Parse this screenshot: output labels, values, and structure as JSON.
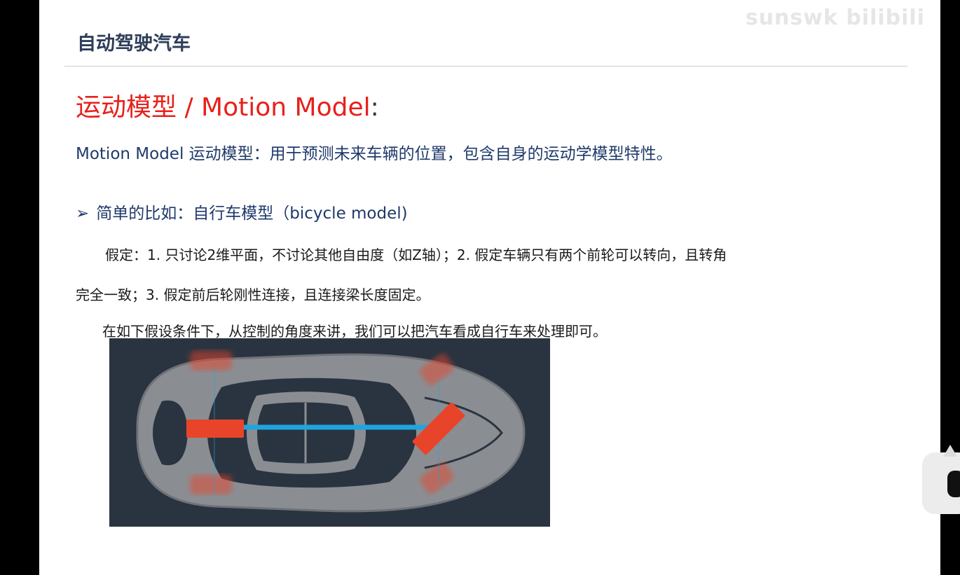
{
  "header": {
    "title": "自动驾驶汽车",
    "watermark": "sunswk bilibili"
  },
  "section": {
    "title": "运动模型 / Motion Model",
    "colon": ":"
  },
  "intro": "Motion Model 运动模型：用于预测未来车辆的位置，包含自身的运动学模型特性。",
  "bullet": {
    "arrow": "➢",
    "text": "简单的比如：自行车模型（bicycle model)"
  },
  "assumptions": {
    "line1": "假定：1. 只讨论2维平面，不讨论其他自由度（如Z轴）；2. 假定车辆只有两个前轮可以转向，且转角",
    "line2": "完全一致；3. 假定前后轮刚性连接，且连接梁长度固定。"
  },
  "conclusion": "在如下假设条件下，从控制的角度来讲，我们可以把汽车看成自行车来处理即可。",
  "figure": {
    "background": "#2a3440",
    "car_body_color": "#8a8e93",
    "wheel_color": "#e8442a",
    "axle_color": "#1ea5e0"
  }
}
